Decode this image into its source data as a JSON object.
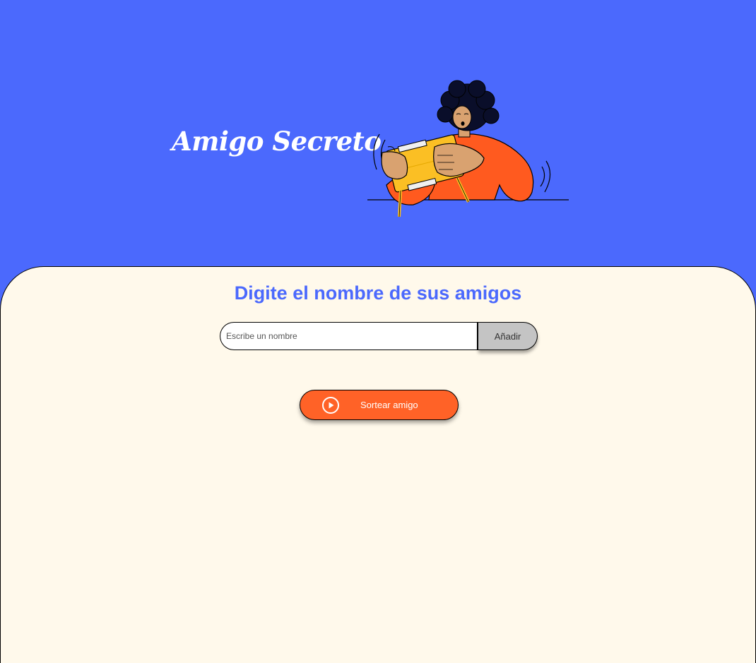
{
  "header": {
    "title": "Amigo Secreto"
  },
  "main": {
    "section_title": "Digite el nombre de sus amigos",
    "name_input": {
      "placeholder": "Escribe un nombre",
      "value": ""
    },
    "add_button_label": "Añadir",
    "draw_button_label": "Sortear amigo",
    "draw_button_icon": "play-circle-icon"
  },
  "illustration": {
    "icon": "person-opening-gift-illustration"
  },
  "colors": {
    "header_background": "#4B69FD",
    "panel_background": "#FFF9EB",
    "accent_blue": "#4B69FD",
    "add_button": "#C4C4C4",
    "draw_button": "#FF6227"
  }
}
